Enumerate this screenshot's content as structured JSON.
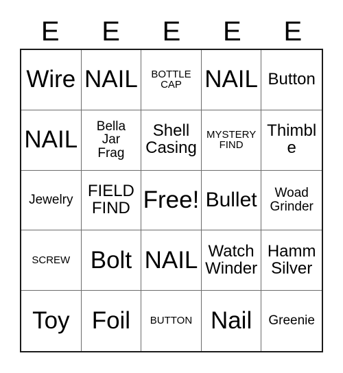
{
  "card": {
    "header": {
      "letters": [
        "E",
        "E",
        "E",
        "E",
        "E"
      ]
    },
    "grid": {
      "rows": 5,
      "columns": 5,
      "free_space_index": 12,
      "cells": [
        {
          "text": "Wire",
          "size": "xl"
        },
        {
          "text": "NAIL",
          "size": "xl"
        },
        {
          "text": "BOTTLE\nCAP",
          "size": "xs"
        },
        {
          "text": "NAIL",
          "size": "xl"
        },
        {
          "text": "Button",
          "size": "md"
        },
        {
          "text": "NAIL",
          "size": "xl"
        },
        {
          "text": "Bella\nJar\nFrag",
          "size": "sm"
        },
        {
          "text": "Shell\nCasing",
          "size": "md"
        },
        {
          "text": "MYSTERY\nFIND",
          "size": "xs"
        },
        {
          "text": "Thimble",
          "size": "md"
        },
        {
          "text": "Jewelry",
          "size": "sm"
        },
        {
          "text": "FIELD\nFIND",
          "size": "md"
        },
        {
          "text": "Free!",
          "size": "xl"
        },
        {
          "text": "Bullet",
          "size": "lg"
        },
        {
          "text": "Woad\nGrinder",
          "size": "sm"
        },
        {
          "text": "SCREW",
          "size": "xs"
        },
        {
          "text": "Bolt",
          "size": "xl"
        },
        {
          "text": "NAIL",
          "size": "xl"
        },
        {
          "text": "Watch\nWinder",
          "size": "md"
        },
        {
          "text": "Hamm\nSilver",
          "size": "md"
        },
        {
          "text": "Toy",
          "size": "xl"
        },
        {
          "text": "Foil",
          "size": "xl"
        },
        {
          "text": "BUTTON",
          "size": "xs"
        },
        {
          "text": "Nail",
          "size": "xl"
        },
        {
          "text": "Greenie",
          "size": "sm"
        }
      ]
    },
    "colors": {
      "background": "#ffffff",
      "text": "#000000",
      "outer_border": "#1a1a1a",
      "inner_border": "#6b6b6b"
    }
  }
}
